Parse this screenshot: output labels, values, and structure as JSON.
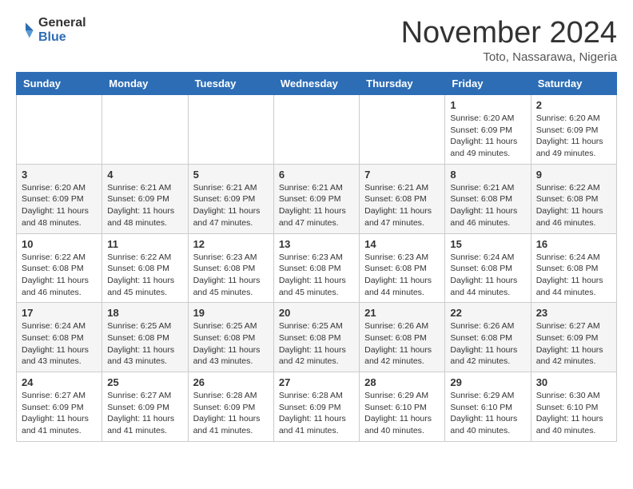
{
  "header": {
    "logo_general": "General",
    "logo_blue": "Blue",
    "month_title": "November 2024",
    "location": "Toto, Nassarawa, Nigeria"
  },
  "days_of_week": [
    "Sunday",
    "Monday",
    "Tuesday",
    "Wednesday",
    "Thursday",
    "Friday",
    "Saturday"
  ],
  "weeks": [
    [
      {
        "day": "",
        "info": ""
      },
      {
        "day": "",
        "info": ""
      },
      {
        "day": "",
        "info": ""
      },
      {
        "day": "",
        "info": ""
      },
      {
        "day": "",
        "info": ""
      },
      {
        "day": "1",
        "info": "Sunrise: 6:20 AM\nSunset: 6:09 PM\nDaylight: 11 hours and 49 minutes."
      },
      {
        "day": "2",
        "info": "Sunrise: 6:20 AM\nSunset: 6:09 PM\nDaylight: 11 hours and 49 minutes."
      }
    ],
    [
      {
        "day": "3",
        "info": "Sunrise: 6:20 AM\nSunset: 6:09 PM\nDaylight: 11 hours and 48 minutes."
      },
      {
        "day": "4",
        "info": "Sunrise: 6:21 AM\nSunset: 6:09 PM\nDaylight: 11 hours and 48 minutes."
      },
      {
        "day": "5",
        "info": "Sunrise: 6:21 AM\nSunset: 6:09 PM\nDaylight: 11 hours and 47 minutes."
      },
      {
        "day": "6",
        "info": "Sunrise: 6:21 AM\nSunset: 6:09 PM\nDaylight: 11 hours and 47 minutes."
      },
      {
        "day": "7",
        "info": "Sunrise: 6:21 AM\nSunset: 6:08 PM\nDaylight: 11 hours and 47 minutes."
      },
      {
        "day": "8",
        "info": "Sunrise: 6:21 AM\nSunset: 6:08 PM\nDaylight: 11 hours and 46 minutes."
      },
      {
        "day": "9",
        "info": "Sunrise: 6:22 AM\nSunset: 6:08 PM\nDaylight: 11 hours and 46 minutes."
      }
    ],
    [
      {
        "day": "10",
        "info": "Sunrise: 6:22 AM\nSunset: 6:08 PM\nDaylight: 11 hours and 46 minutes."
      },
      {
        "day": "11",
        "info": "Sunrise: 6:22 AM\nSunset: 6:08 PM\nDaylight: 11 hours and 45 minutes."
      },
      {
        "day": "12",
        "info": "Sunrise: 6:23 AM\nSunset: 6:08 PM\nDaylight: 11 hours and 45 minutes."
      },
      {
        "day": "13",
        "info": "Sunrise: 6:23 AM\nSunset: 6:08 PM\nDaylight: 11 hours and 45 minutes."
      },
      {
        "day": "14",
        "info": "Sunrise: 6:23 AM\nSunset: 6:08 PM\nDaylight: 11 hours and 44 minutes."
      },
      {
        "day": "15",
        "info": "Sunrise: 6:24 AM\nSunset: 6:08 PM\nDaylight: 11 hours and 44 minutes."
      },
      {
        "day": "16",
        "info": "Sunrise: 6:24 AM\nSunset: 6:08 PM\nDaylight: 11 hours and 44 minutes."
      }
    ],
    [
      {
        "day": "17",
        "info": "Sunrise: 6:24 AM\nSunset: 6:08 PM\nDaylight: 11 hours and 43 minutes."
      },
      {
        "day": "18",
        "info": "Sunrise: 6:25 AM\nSunset: 6:08 PM\nDaylight: 11 hours and 43 minutes."
      },
      {
        "day": "19",
        "info": "Sunrise: 6:25 AM\nSunset: 6:08 PM\nDaylight: 11 hours and 43 minutes."
      },
      {
        "day": "20",
        "info": "Sunrise: 6:25 AM\nSunset: 6:08 PM\nDaylight: 11 hours and 42 minutes."
      },
      {
        "day": "21",
        "info": "Sunrise: 6:26 AM\nSunset: 6:08 PM\nDaylight: 11 hours and 42 minutes."
      },
      {
        "day": "22",
        "info": "Sunrise: 6:26 AM\nSunset: 6:08 PM\nDaylight: 11 hours and 42 minutes."
      },
      {
        "day": "23",
        "info": "Sunrise: 6:27 AM\nSunset: 6:09 PM\nDaylight: 11 hours and 42 minutes."
      }
    ],
    [
      {
        "day": "24",
        "info": "Sunrise: 6:27 AM\nSunset: 6:09 PM\nDaylight: 11 hours and 41 minutes."
      },
      {
        "day": "25",
        "info": "Sunrise: 6:27 AM\nSunset: 6:09 PM\nDaylight: 11 hours and 41 minutes."
      },
      {
        "day": "26",
        "info": "Sunrise: 6:28 AM\nSunset: 6:09 PM\nDaylight: 11 hours and 41 minutes."
      },
      {
        "day": "27",
        "info": "Sunrise: 6:28 AM\nSunset: 6:09 PM\nDaylight: 11 hours and 41 minutes."
      },
      {
        "day": "28",
        "info": "Sunrise: 6:29 AM\nSunset: 6:10 PM\nDaylight: 11 hours and 40 minutes."
      },
      {
        "day": "29",
        "info": "Sunrise: 6:29 AM\nSunset: 6:10 PM\nDaylight: 11 hours and 40 minutes."
      },
      {
        "day": "30",
        "info": "Sunrise: 6:30 AM\nSunset: 6:10 PM\nDaylight: 11 hours and 40 minutes."
      }
    ]
  ]
}
